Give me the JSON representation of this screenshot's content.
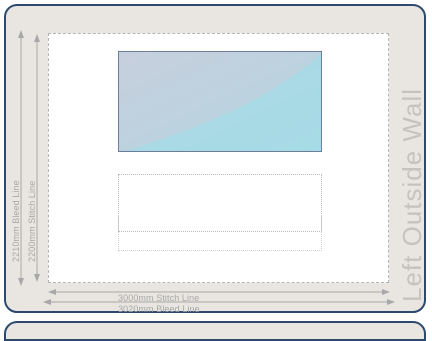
{
  "dimensions": {
    "bleed_height_label": "2210mm Bleed Line",
    "stitch_height_label": "2200mm Stitch Line",
    "stitch_width_label": "3000mm Stitch Line",
    "bleed_width_label": "3020mm Bleed Line"
  },
  "wall": {
    "name": "Left Outside Wall"
  },
  "colors": {
    "frame_border": "#2d4a6e",
    "frame_fill": "#e9e6e1",
    "graphic_fill": "#bcd2df",
    "dimension_lines": "#a8a8a8"
  }
}
